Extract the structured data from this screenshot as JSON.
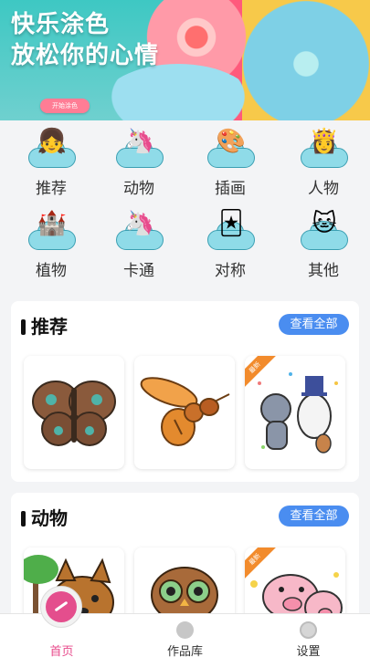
{
  "banner": {
    "line1": "快乐涂色",
    "line2": "放松你的心情",
    "button_label": "开始涂色"
  },
  "categories": [
    {
      "label": "推荐",
      "icon": "girl-icon"
    },
    {
      "label": "动物",
      "icon": "unicorn-icon"
    },
    {
      "label": "插画",
      "icon": "easel-icon"
    },
    {
      "label": "人物",
      "icon": "princess-icon"
    },
    {
      "label": "植物",
      "icon": "castle-icon"
    },
    {
      "label": "卡通",
      "icon": "cartoon-unicorn-icon"
    },
    {
      "label": "对称",
      "icon": "cards-icon"
    },
    {
      "label": "其他",
      "icon": "cat-icon"
    }
  ],
  "sections": [
    {
      "title": "推荐",
      "see_all": "查看全部",
      "cards": [
        {
          "image": "butterfly-picture",
          "new_tag": ""
        },
        {
          "image": "bee-picture",
          "new_tag": ""
        },
        {
          "image": "tom-and-jerry-picture",
          "new_tag": "最新"
        }
      ]
    },
    {
      "title": "动物",
      "see_all": "查看全部",
      "cards": [
        {
          "image": "fox-picture",
          "new_tag": ""
        },
        {
          "image": "owl-picture",
          "new_tag": ""
        },
        {
          "image": "pigs-picture",
          "new_tag": "最新"
        }
      ]
    }
  ],
  "tabbar": {
    "tabs": [
      {
        "label": "首页",
        "active": true
      },
      {
        "label": "作品库",
        "active": false
      },
      {
        "label": "设置",
        "active": false
      }
    ]
  },
  "colors": {
    "accent_pink": "#e84b8c",
    "button_blue": "#4a8df0",
    "tag_orange": "#f28b2c",
    "cloud_teal": "#8fdbe8"
  }
}
